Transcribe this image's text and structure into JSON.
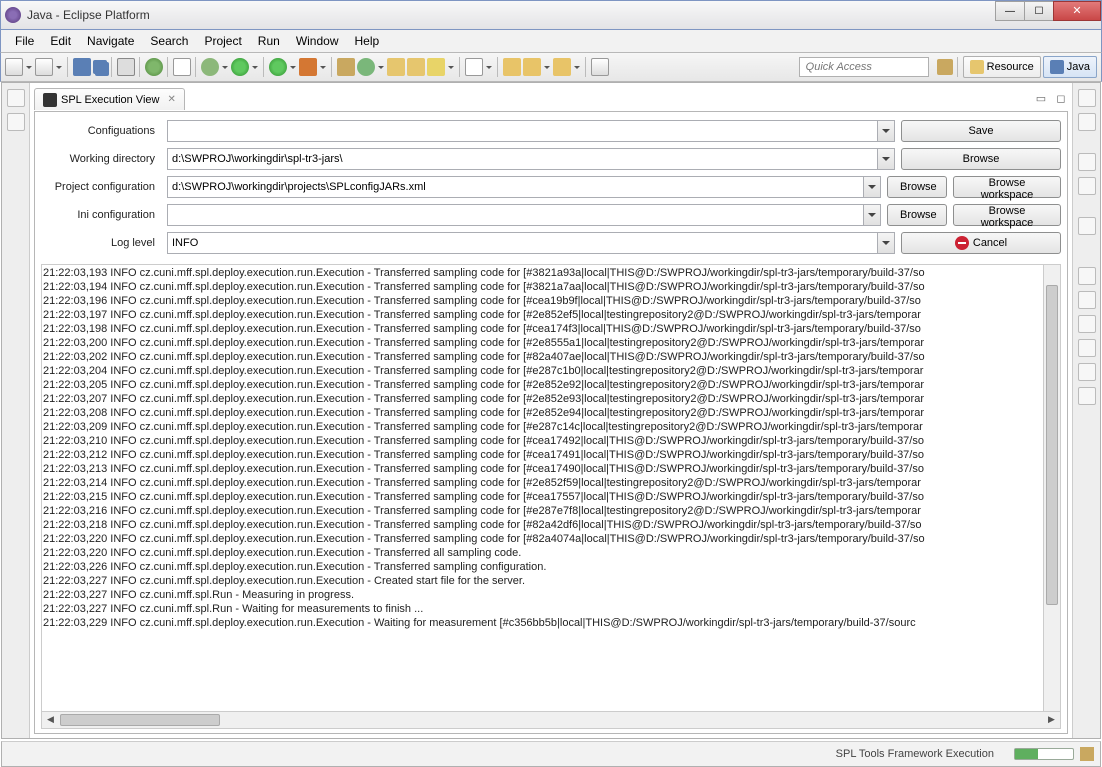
{
  "window": {
    "title": "Java - Eclipse Platform"
  },
  "menu": [
    "File",
    "Edit",
    "Navigate",
    "Search",
    "Project",
    "Run",
    "Window",
    "Help"
  ],
  "quickAccess": {
    "placeholder": "Quick Access"
  },
  "perspectives": {
    "resource": "Resource",
    "java": "Java"
  },
  "view": {
    "tab": "SPL Execution View",
    "labels": {
      "configurations": "Configuations",
      "workingDir": "Working directory",
      "projectConfig": "Project configuration",
      "iniConfig": "Ini configuration",
      "logLevel": "Log level"
    },
    "values": {
      "configurations": "",
      "workingDir": "d:\\SWPROJ\\workingdir\\spl-tr3-jars\\",
      "projectConfig": "d:\\SWPROJ\\workingdir\\projects\\SPLconfigJARs.xml",
      "iniConfig": "",
      "logLevel": "INFO"
    },
    "buttons": {
      "save": "Save",
      "browse": "Browse",
      "browseWorkspace": "Browse workspace",
      "cancel": "Cancel"
    }
  },
  "log": [
    "21:22:03,193 INFO cz.cuni.mff.spl.deploy.execution.run.Execution - Transferred sampling code for [#3821a93a|local|THIS@D:/SWPROJ/workingdir/spl-tr3-jars/temporary/build-37/so",
    "21:22:03,194 INFO cz.cuni.mff.spl.deploy.execution.run.Execution - Transferred sampling code for [#3821a7aa|local|THIS@D:/SWPROJ/workingdir/spl-tr3-jars/temporary/build-37/so",
    "21:22:03,196 INFO cz.cuni.mff.spl.deploy.execution.run.Execution - Transferred sampling code for [#cea19b9f|local|THIS@D:/SWPROJ/workingdir/spl-tr3-jars/temporary/build-37/so",
    "21:22:03,197 INFO cz.cuni.mff.spl.deploy.execution.run.Execution - Transferred sampling code for [#2e852ef5|local|testingrepository2@D:/SWPROJ/workingdir/spl-tr3-jars/temporar",
    "21:22:03,198 INFO cz.cuni.mff.spl.deploy.execution.run.Execution - Transferred sampling code for [#cea174f3|local|THIS@D:/SWPROJ/workingdir/spl-tr3-jars/temporary/build-37/so",
    "21:22:03,200 INFO cz.cuni.mff.spl.deploy.execution.run.Execution - Transferred sampling code for [#2e8555a1|local|testingrepository2@D:/SWPROJ/workingdir/spl-tr3-jars/temporar",
    "21:22:03,202 INFO cz.cuni.mff.spl.deploy.execution.run.Execution - Transferred sampling code for [#82a407ae|local|THIS@D:/SWPROJ/workingdir/spl-tr3-jars/temporary/build-37/so",
    "21:22:03,204 INFO cz.cuni.mff.spl.deploy.execution.run.Execution - Transferred sampling code for [#e287c1b0|local|testingrepository2@D:/SWPROJ/workingdir/spl-tr3-jars/temporar",
    "21:22:03,205 INFO cz.cuni.mff.spl.deploy.execution.run.Execution - Transferred sampling code for [#2e852e92|local|testingrepository2@D:/SWPROJ/workingdir/spl-tr3-jars/temporar",
    "21:22:03,207 INFO cz.cuni.mff.spl.deploy.execution.run.Execution - Transferred sampling code for [#2e852e93|local|testingrepository2@D:/SWPROJ/workingdir/spl-tr3-jars/temporar",
    "21:22:03,208 INFO cz.cuni.mff.spl.deploy.execution.run.Execution - Transferred sampling code for [#2e852e94|local|testingrepository2@D:/SWPROJ/workingdir/spl-tr3-jars/temporar",
    "21:22:03,209 INFO cz.cuni.mff.spl.deploy.execution.run.Execution - Transferred sampling code for [#e287c14c|local|testingrepository2@D:/SWPROJ/workingdir/spl-tr3-jars/temporar",
    "21:22:03,210 INFO cz.cuni.mff.spl.deploy.execution.run.Execution - Transferred sampling code for [#cea17492|local|THIS@D:/SWPROJ/workingdir/spl-tr3-jars/temporary/build-37/so",
    "21:22:03,212 INFO cz.cuni.mff.spl.deploy.execution.run.Execution - Transferred sampling code for [#cea17491|local|THIS@D:/SWPROJ/workingdir/spl-tr3-jars/temporary/build-37/so",
    "21:22:03,213 INFO cz.cuni.mff.spl.deploy.execution.run.Execution - Transferred sampling code for [#cea17490|local|THIS@D:/SWPROJ/workingdir/spl-tr3-jars/temporary/build-37/so",
    "21:22:03,214 INFO cz.cuni.mff.spl.deploy.execution.run.Execution - Transferred sampling code for [#2e852f59|local|testingrepository2@D:/SWPROJ/workingdir/spl-tr3-jars/temporar",
    "21:22:03,215 INFO cz.cuni.mff.spl.deploy.execution.run.Execution - Transferred sampling code for [#cea17557|local|THIS@D:/SWPROJ/workingdir/spl-tr3-jars/temporary/build-37/so",
    "21:22:03,216 INFO cz.cuni.mff.spl.deploy.execution.run.Execution - Transferred sampling code for [#e287e7f8|local|testingrepository2@D:/SWPROJ/workingdir/spl-tr3-jars/temporar",
    "21:22:03,218 INFO cz.cuni.mff.spl.deploy.execution.run.Execution - Transferred sampling code for [#82a42df6|local|THIS@D:/SWPROJ/workingdir/spl-tr3-jars/temporary/build-37/so",
    "21:22:03,220 INFO cz.cuni.mff.spl.deploy.execution.run.Execution - Transferred sampling code for [#82a4074a|local|THIS@D:/SWPROJ/workingdir/spl-tr3-jars/temporary/build-37/so",
    "21:22:03,220 INFO cz.cuni.mff.spl.deploy.execution.run.Execution - Transferred all sampling code.",
    "21:22:03,226 INFO cz.cuni.mff.spl.deploy.execution.run.Execution - Transferred sampling configuration.",
    "21:22:03,227 INFO cz.cuni.mff.spl.deploy.execution.run.Execution - Created start file for the server.",
    "21:22:03,227 INFO cz.cuni.mff.spl.Run - Measuring in progress.",
    "21:22:03,227 INFO cz.cuni.mff.spl.Run - Waiting for measurements to finish ...",
    "21:22:03,229 INFO cz.cuni.mff.spl.deploy.execution.run.Execution - Waiting for measurement [#c356bb5b|local|THIS@D:/SWPROJ/workingdir/spl-tr3-jars/temporary/build-37/sourc"
  ],
  "status": {
    "text": "SPL Tools Framework Execution"
  }
}
